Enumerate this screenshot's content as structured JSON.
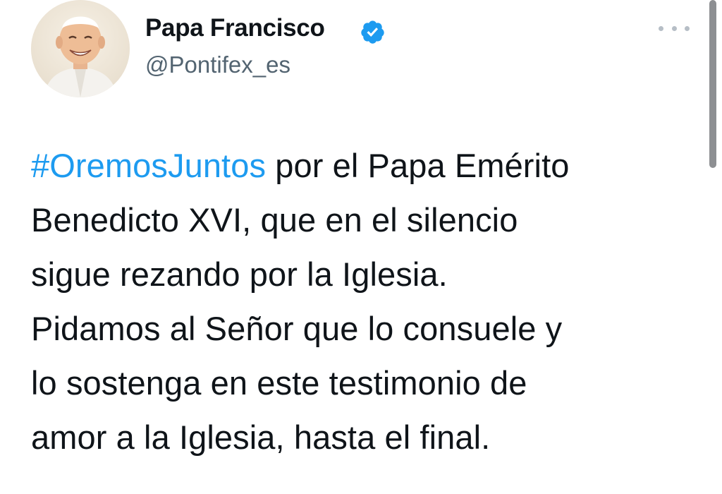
{
  "tweet": {
    "author": {
      "display_name": "Papa Francisco",
      "handle": "@Pontifex_es",
      "verified": true,
      "avatar_icon": "profile-photo"
    },
    "more_icon": "ellipsis-icon",
    "hashtag": "#OremosJuntos",
    "text_lines": [
      " por el Papa Emérito",
      "Benedicto XVI, que en el silencio",
      "sigue rezando por la Iglesia.",
      "Pidamos al Señor que lo consuele y",
      "lo sostenga en este testimonio de",
      "amor a la Iglesia, hasta el final."
    ]
  },
  "colors": {
    "text": "#0f1419",
    "secondary": "#536471",
    "link": "#1d9bf0",
    "verified": "#1d9bf0"
  }
}
